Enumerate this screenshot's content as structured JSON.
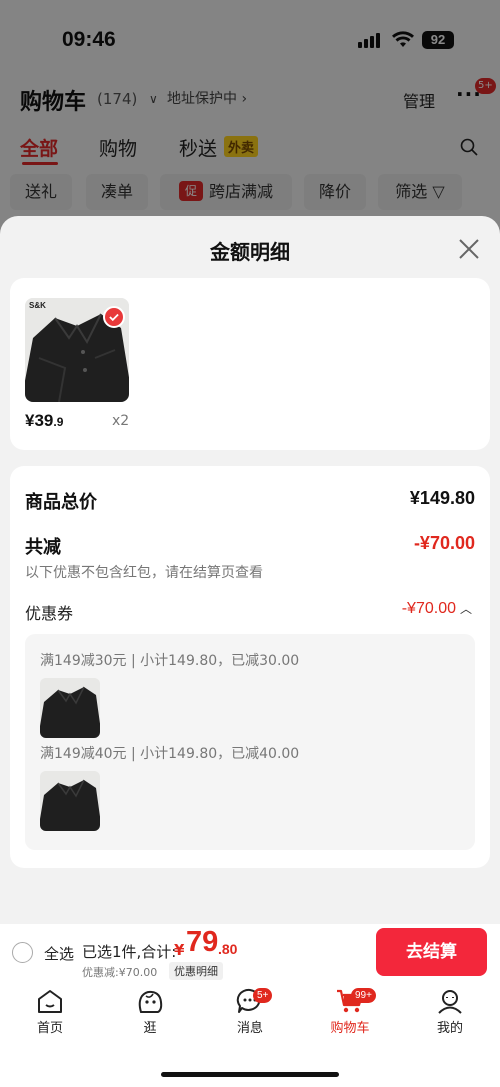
{
  "status_bar": {
    "time": "09:46",
    "battery": "92"
  },
  "cart_header": {
    "title": "购物车",
    "count": "(174)",
    "address_protect": "地址保护中",
    "manage": "管理",
    "more_badge": "5+"
  },
  "tabs": [
    {
      "label": "全部",
      "active": true
    },
    {
      "label": "购物",
      "active": false
    },
    {
      "label": "秒送",
      "active": false,
      "tag": "外卖"
    }
  ],
  "filter_chips": [
    "送礼",
    "凑单",
    "跨店满减",
    "降价",
    "筛选"
  ],
  "filter_promo_tag": "促",
  "sheet": {
    "title": "金额明细",
    "product": {
      "brand_tag": "S&K",
      "price_main": "¥39",
      "price_decimal": ".9",
      "quantity": "x2"
    },
    "total_label": "商品总价",
    "total_value": "¥149.80",
    "reduce_label": "共减",
    "reduce_value": "-¥70.00",
    "note": "以下优惠不包含红包，请在结算页查看",
    "coupon_label": "优惠券",
    "coupon_value": "-¥70.00",
    "coupon_lines": [
      "满149减30元 | 小计149.80，已减30.00",
      "满149减40元 | 小计149.80，已减40.00"
    ]
  },
  "checkout": {
    "select_all": "全选",
    "summary": "已选1件,合计:",
    "currency": "¥",
    "total_int": "79",
    "total_dec": ".80",
    "discount": "优惠减:¥70.00",
    "detail_link": "优惠明细",
    "button": "去结算"
  },
  "tabbar": [
    {
      "label": "首页",
      "icon": "home-icon"
    },
    {
      "label": "逛",
      "icon": "face-icon"
    },
    {
      "label": "消息",
      "icon": "message-icon",
      "badge": "5+"
    },
    {
      "label": "购物车",
      "icon": "cart-icon",
      "badge": "99+",
      "active": true
    },
    {
      "label": "我的",
      "icon": "person-icon"
    }
  ],
  "colors": {
    "accent": "#e0281e",
    "checkout_button": "#f3273b",
    "takeout_tag": "#ffd21f"
  }
}
